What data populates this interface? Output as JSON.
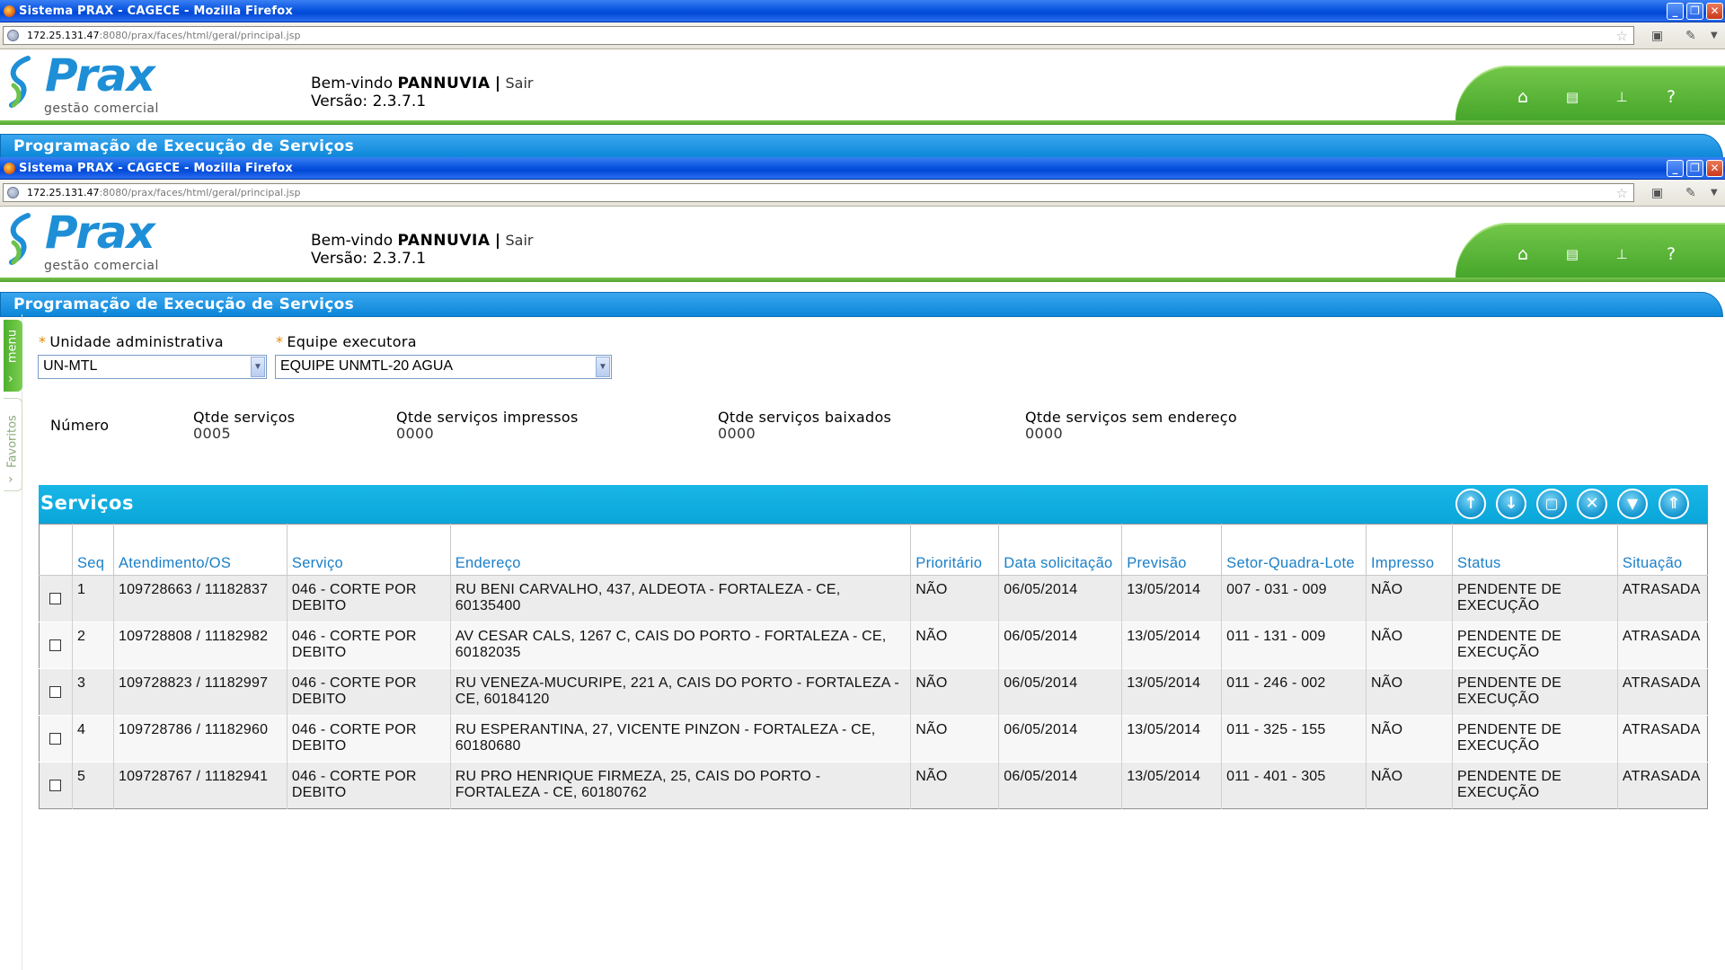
{
  "browser": {
    "title": "Sistema PRAX - CAGECE - Mozilla Firefox",
    "url_host": "172.25.131.47",
    "url_path": ":8080/prax/faces/html/geral/principal.jsp"
  },
  "header": {
    "brand": "Prax",
    "tagline": "gestão comercial",
    "welcome_prefix": "Bem-vindo",
    "user": "PANNUVIA",
    "separator": "|",
    "logout": "Sair",
    "version": "Versão: 2.3.7.1",
    "nav_icons": [
      "home-icon",
      "print-icon",
      "sitemap-icon",
      "help-icon"
    ],
    "help_glyph": "?"
  },
  "page_title": "Programação de Execução de Serviços",
  "side": {
    "menu_label": "menu",
    "favorites_label": "Favoritos"
  },
  "form": {
    "unidade_label": "Unidade administrativa",
    "unidade_value": "UN-MTL",
    "equipe_label": "Equipe executora",
    "equipe_value": "EQUIPE UNMTL-20 AGUA",
    "required_mark": "*"
  },
  "stats": {
    "numero_label": "Número",
    "qtde_servicos_label": "Qtde serviços",
    "qtde_servicos_value": "0005",
    "qtde_impressos_label": "Qtde serviços impressos",
    "qtde_impressos_value": "0000",
    "qtde_baixados_label": "Qtde serviços baixados",
    "qtde_baixados_value": "0000",
    "qtde_sem_endereco_label": "Qtde serviços sem endereço",
    "qtde_sem_endereco_value": "0000"
  },
  "services": {
    "title": "Serviços",
    "toolbar": [
      "move-up-icon",
      "move-down-icon",
      "select-all-icon",
      "remove-icon",
      "filter-icon",
      "collapse-icon"
    ],
    "columns": [
      "",
      "Seq",
      "Atendimento/OS",
      "Serviço",
      "Endereço",
      "Prioritário",
      "Data solicitação",
      "Previsão",
      "Setor-Quadra-Lote",
      "Impresso",
      "Status",
      "Situação"
    ],
    "rows": [
      {
        "seq": "1",
        "atendimento": "109728663 / 11182837",
        "servico": "046 - CORTE POR DEBITO",
        "endereco": "RU BENI CARVALHO, 437, ALDEOTA - FORTALEZA - CE, 60135400",
        "prioritario": "NÃO",
        "data": "06/05/2014",
        "previsao": "13/05/2014",
        "sql": "007 - 031 - 009",
        "impresso": "NÃO",
        "status": "PENDENTE DE EXECUÇÃO",
        "situacao": "ATRASADA"
      },
      {
        "seq": "2",
        "atendimento": "109728808 / 11182982",
        "servico": "046 - CORTE POR DEBITO",
        "endereco": "AV CESAR CALS, 1267 C, CAIS DO PORTO - FORTALEZA - CE, 60182035",
        "prioritario": "NÃO",
        "data": "06/05/2014",
        "previsao": "13/05/2014",
        "sql": "011 - 131 - 009",
        "impresso": "NÃO",
        "status": "PENDENTE DE EXECUÇÃO",
        "situacao": "ATRASADA"
      },
      {
        "seq": "3",
        "atendimento": "109728823 / 11182997",
        "servico": "046 - CORTE POR DEBITO",
        "endereco": "RU VENEZA-MUCURIPE, 221 A, CAIS DO PORTO - FORTALEZA - CE, 60184120",
        "prioritario": "NÃO",
        "data": "06/05/2014",
        "previsao": "13/05/2014",
        "sql": "011 - 246 - 002",
        "impresso": "NÃO",
        "status": "PENDENTE DE EXECUÇÃO",
        "situacao": "ATRASADA"
      },
      {
        "seq": "4",
        "atendimento": "109728786 / 11182960",
        "servico": "046 - CORTE POR DEBITO",
        "endereco": "RU ESPERANTINA, 27, VICENTE PINZON - FORTALEZA - CE, 60180680",
        "prioritario": "NÃO",
        "data": "06/05/2014",
        "previsao": "13/05/2014",
        "sql": "011 - 325 - 155",
        "impresso": "NÃO",
        "status": "PENDENTE DE EXECUÇÃO",
        "situacao": "ATRASADA"
      },
      {
        "seq": "5",
        "atendimento": "109728767 / 11182941",
        "servico": "046 - CORTE POR DEBITO",
        "endereco": "RU PRO HENRIQUE FIRMEZA, 25, CAIS DO PORTO - FORTALEZA - CE, 60180762",
        "prioritario": "NÃO",
        "data": "06/05/2014",
        "previsao": "13/05/2014",
        "sql": "011 - 401 - 305",
        "impresso": "NÃO",
        "status": "PENDENTE DE EXECUÇÃO",
        "situacao": "ATRASADA"
      }
    ]
  },
  "colors": {
    "brand_blue": "#1e8fd6",
    "green": "#4ea32c",
    "panel_cyan": "#0aa6da",
    "header_text_blue": "#1a7fc8"
  }
}
